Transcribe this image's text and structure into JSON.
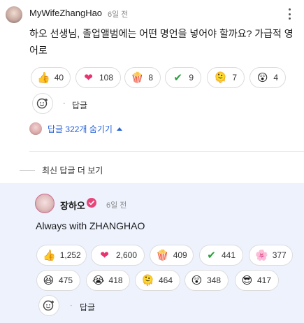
{
  "comment": {
    "author": "MyWifeZhangHao",
    "time": "6일 전",
    "text": "하오 선생님, 졸업앨범에는 어떤 명언을 넣어야 할까요? 가급적 영어로",
    "reactions": [
      {
        "icon": "thumbs-up-icon",
        "emoji": "👍",
        "count": "40"
      },
      {
        "icon": "heart-icon",
        "emoji": "❤",
        "count": "108"
      },
      {
        "icon": "popcorn-icon",
        "emoji": "🍿",
        "count": "8"
      },
      {
        "icon": "checkmark-icon",
        "emoji": "✔",
        "count": "9"
      },
      {
        "icon": "melting-face-icon",
        "emoji": "🫠",
        "count": "7"
      },
      {
        "icon": "surprised-face-icon",
        "emoji": "😲",
        "count": "4"
      }
    ],
    "dot": "·",
    "reply_label": "답글",
    "replies_toggle": "답글 322개 숨기기"
  },
  "more_replies_label": "최신 답글 더 보기",
  "reply": {
    "author": "장하오",
    "time": "6일 전",
    "text": "Always with ZHANGHAO",
    "reactions": [
      {
        "icon": "thumbs-up-icon",
        "emoji": "👍",
        "count": "1,252"
      },
      {
        "icon": "heart-icon",
        "emoji": "❤",
        "count": "2,600"
      },
      {
        "icon": "popcorn-icon",
        "emoji": "🍿",
        "count": "409"
      },
      {
        "icon": "checkmark-icon",
        "emoji": "✔",
        "count": "441"
      },
      {
        "icon": "flower-icon",
        "emoji": "🌸",
        "count": "377"
      },
      {
        "icon": "laughing-face-icon",
        "emoji": "😆",
        "count": "475"
      },
      {
        "icon": "crying-face-icon",
        "emoji": "😭",
        "count": "418"
      },
      {
        "icon": "melting-face-icon",
        "emoji": "🫠",
        "count": "464"
      },
      {
        "icon": "surprised-face-icon",
        "emoji": "😲",
        "count": "348"
      },
      {
        "icon": "sunglasses-face-icon",
        "emoji": "😎",
        "count": "417"
      }
    ],
    "dot": "·",
    "reply_label": "답글"
  },
  "colors": {
    "link": "#2a64d8",
    "reply_bg": "#edf2fd",
    "verify": "#e8467a",
    "heart": "#e8336f"
  }
}
